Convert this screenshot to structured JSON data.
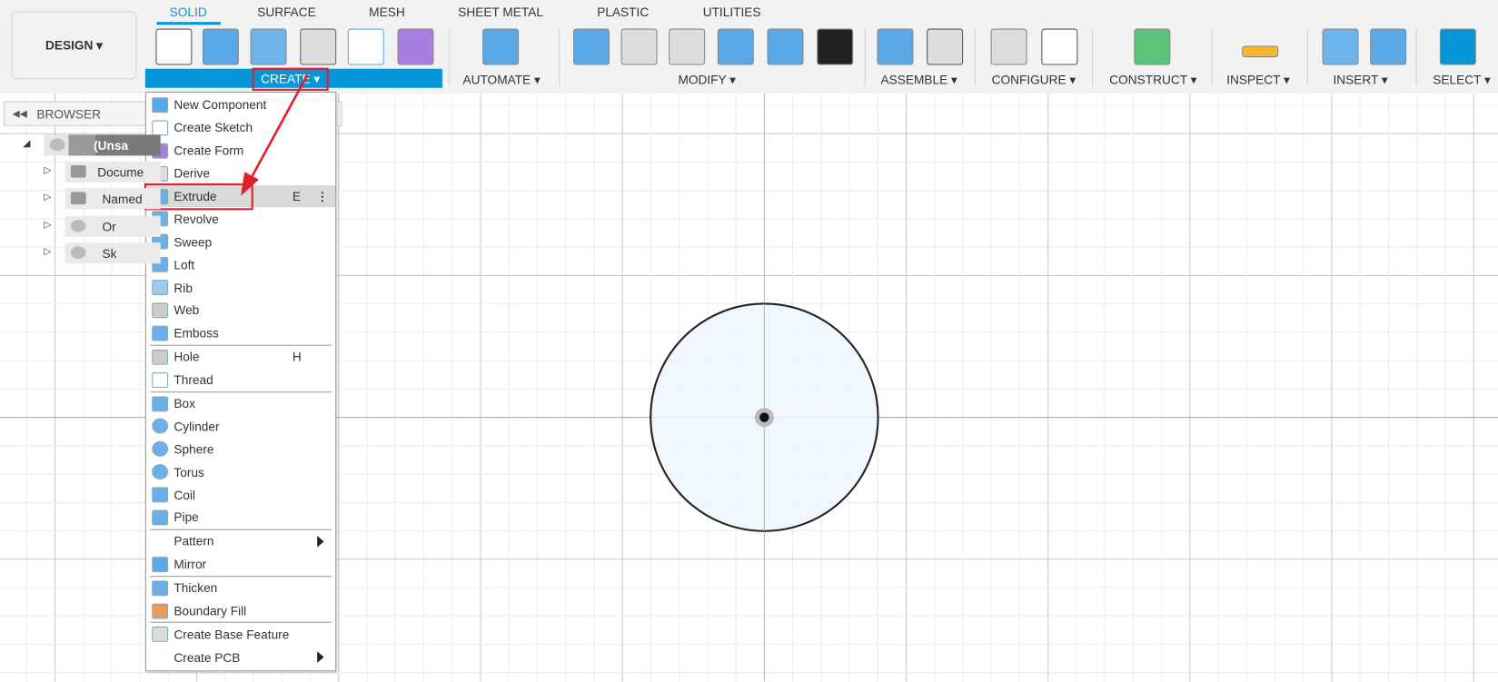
{
  "toolbar": {
    "workspace": "DESIGN ▾",
    "tabs": [
      "SOLID",
      "SURFACE",
      "MESH",
      "SHEET METAL",
      "PLASTIC",
      "UTILITIES"
    ],
    "active_tab": "SOLID",
    "groups": [
      "CREATE ▾",
      "AUTOMATE ▾",
      "MODIFY ▾",
      "ASSEMBLE ▾",
      "CONFIGURE ▾",
      "CONSTRUCT ▾",
      "INSPECT ▾",
      "INSERT ▾",
      "SELECT ▾"
    ]
  },
  "browser": {
    "title": "BROWSER",
    "items": [
      "(Unsa",
      "Docume",
      "Named",
      "Or",
      "Sk"
    ]
  },
  "create_menu": {
    "items": [
      {
        "label": "New Component",
        "icon": "new-component-icon"
      },
      {
        "label": "Create Sketch",
        "icon": "sketch-icon"
      },
      {
        "label": "Create Form",
        "icon": "form-icon"
      },
      {
        "label": "Derive",
        "icon": "derive-icon"
      },
      {
        "label": "Extrude",
        "icon": "extrude-icon",
        "shortcut": "E",
        "highlighted": true
      },
      {
        "label": "Revolve",
        "icon": "revolve-icon"
      },
      {
        "label": "Sweep",
        "icon": "sweep-icon"
      },
      {
        "label": "Loft",
        "icon": "loft-icon"
      },
      {
        "label": "Rib",
        "icon": "rib-icon"
      },
      {
        "label": "Web",
        "icon": "web-icon"
      },
      {
        "label": "Emboss",
        "icon": "emboss-icon",
        "sep": true
      },
      {
        "label": "Hole",
        "icon": "hole-icon",
        "shortcut": "H"
      },
      {
        "label": "Thread",
        "icon": "thread-icon",
        "sep": true
      },
      {
        "label": "Box",
        "icon": "box-icon"
      },
      {
        "label": "Cylinder",
        "icon": "cylinder-icon"
      },
      {
        "label": "Sphere",
        "icon": "sphere-icon"
      },
      {
        "label": "Torus",
        "icon": "torus-icon"
      },
      {
        "label": "Coil",
        "icon": "coil-icon"
      },
      {
        "label": "Pipe",
        "icon": "pipe-icon",
        "sep": true
      },
      {
        "label": "Pattern",
        "submenu": true
      },
      {
        "label": "Mirror",
        "icon": "mirror-icon",
        "sep": true
      },
      {
        "label": "Thicken",
        "icon": "thicken-icon"
      },
      {
        "label": "Boundary Fill",
        "icon": "boundary-fill-icon",
        "sep": true
      },
      {
        "label": "Create Base Feature",
        "icon": "base-feature-icon"
      },
      {
        "label": "Create PCB",
        "submenu": true
      }
    ]
  },
  "colors": {
    "accent": "#0696d7",
    "highlight_red": "#e0202a",
    "sketch_fill": "#eef6fc",
    "x_axis": "#e88080",
    "y_axis": "#7de07d"
  }
}
